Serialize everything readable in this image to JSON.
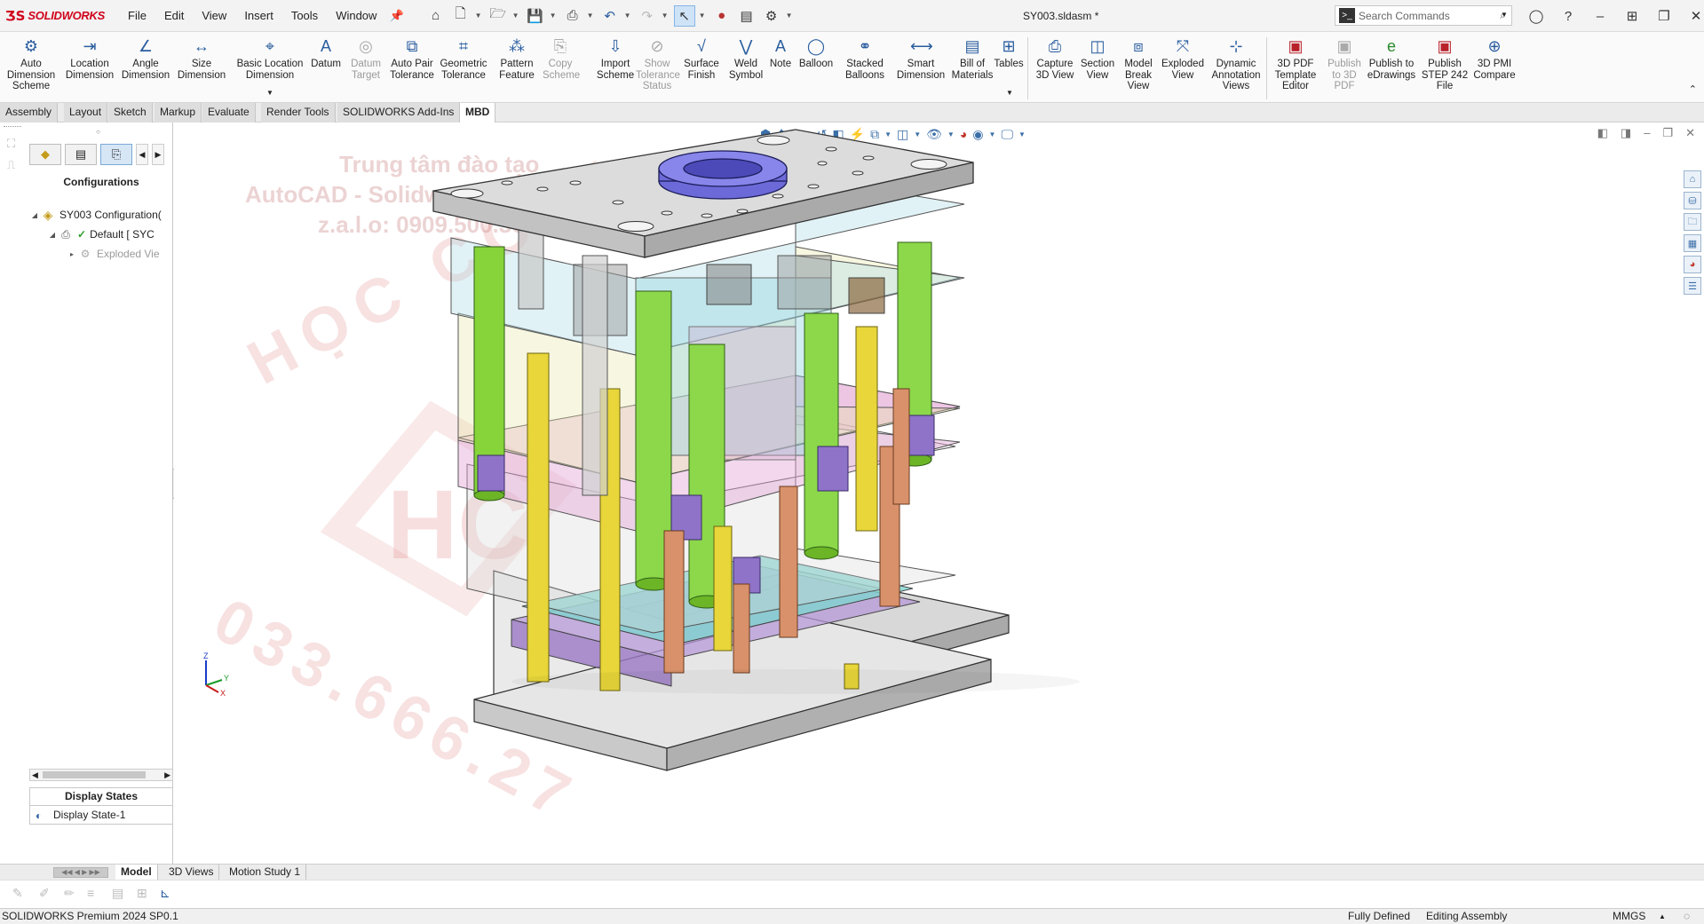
{
  "app": {
    "name": "SOLIDWORKS",
    "doc_title": "SY003.sldasm *"
  },
  "menu": [
    "File",
    "Edit",
    "View",
    "Insert",
    "Tools",
    "Window"
  ],
  "search": {
    "placeholder": "Search Commands"
  },
  "ribbon": [
    {
      "label": "Auto Dimension Scheme",
      "icon": "auto-dimension-icon",
      "enabled": true
    },
    {
      "label": "Location Dimension",
      "icon": "location-dimension-icon",
      "enabled": true
    },
    {
      "label": "Angle Dimension",
      "icon": "angle-dimension-icon",
      "enabled": true
    },
    {
      "label": "Size Dimension",
      "icon": "size-dimension-icon",
      "enabled": true
    },
    {
      "label": "Basic Location Dimension",
      "icon": "basic-location-icon",
      "enabled": true
    },
    {
      "label": "Datum",
      "icon": "datum-icon",
      "enabled": true
    },
    {
      "label": "Datum Target",
      "icon": "datum-target-icon",
      "enabled": false
    },
    {
      "label": "Auto Pair Tolerance",
      "icon": "auto-pair-icon",
      "enabled": true
    },
    {
      "label": "Geometric Tolerance",
      "icon": "geometric-tolerance-icon",
      "enabled": true
    },
    {
      "label": "Pattern Feature",
      "icon": "pattern-feature-icon",
      "enabled": true
    },
    {
      "label": "Copy Scheme",
      "icon": "copy-scheme-icon",
      "enabled": false
    },
    {
      "label": "Import Scheme",
      "icon": "import-scheme-icon",
      "enabled": true
    },
    {
      "label": "Show Tolerance Status",
      "icon": "tolerance-status-icon",
      "enabled": false
    },
    {
      "label": "Surface Finish",
      "icon": "surface-finish-icon",
      "enabled": true
    },
    {
      "label": "Weld Symbol",
      "icon": "weld-symbol-icon",
      "enabled": true
    },
    {
      "label": "Note",
      "icon": "note-icon",
      "enabled": true
    },
    {
      "label": "Balloon",
      "icon": "balloon-icon",
      "enabled": true
    },
    {
      "label": "Stacked Balloons",
      "icon": "stacked-balloons-icon",
      "enabled": true
    },
    {
      "label": "Smart Dimension",
      "icon": "smart-dimension-icon",
      "enabled": true
    },
    {
      "label": "Bill of Materials",
      "icon": "bill-of-materials-icon",
      "enabled": true
    },
    {
      "label": "Tables",
      "icon": "tables-icon",
      "enabled": true
    },
    {
      "label": "Capture 3D View",
      "icon": "capture-3d-view-icon",
      "enabled": true
    },
    {
      "label": "Section View",
      "icon": "section-view-icon",
      "enabled": true
    },
    {
      "label": "Model Break View",
      "icon": "model-break-view-icon",
      "enabled": true
    },
    {
      "label": "Exploded View",
      "icon": "exploded-view-icon",
      "enabled": true
    },
    {
      "label": "Dynamic Annotation Views",
      "icon": "dynamic-annotation-icon",
      "enabled": true
    },
    {
      "label": "3D PDF Template Editor",
      "icon": "pdf-template-icon",
      "enabled": true
    },
    {
      "label": "Publish to 3D PDF",
      "icon": "publish-3d-pdf-icon",
      "enabled": false
    },
    {
      "label": "Publish to eDrawings",
      "icon": "edrawings-icon",
      "enabled": true
    },
    {
      "label": "Publish STEP 242 File",
      "icon": "step-242-icon",
      "enabled": true
    },
    {
      "label": "3D PMI Compare",
      "icon": "pmi-compare-icon",
      "enabled": true
    }
  ],
  "tabs": [
    "Assembly",
    "Layout",
    "Sketch",
    "Markup",
    "Evaluate",
    "Render Tools",
    "SOLIDWORKS Add-Ins",
    "MBD"
  ],
  "active_tab": "MBD",
  "panel": {
    "title": "Configurations",
    "tree": [
      {
        "label": "SY003 Configuration(",
        "level": 0
      },
      {
        "label": "Default [ SYC",
        "level": 1
      },
      {
        "label": "Exploded Vie",
        "level": 2
      }
    ],
    "display_states_title": "Display States",
    "display_state": "Display State-1"
  },
  "watermark": {
    "line1": "Trung tâm đào tạo",
    "line2": "AutoCAD - Solidworks - Mastercam",
    "line3": "z.a.l.o: 0909.500.365",
    "arc_text": "HỌC CƠ K",
    "logo_text": "HC",
    "phone": "033.666.27"
  },
  "bottom_tabs": [
    "Model",
    "3D Views",
    "Motion Study 1"
  ],
  "status": {
    "left": "SOLIDWORKS Premium 2024 SP0.1",
    "defined": "Fully Defined",
    "mode": "Editing Assembly",
    "units": "MMGS"
  }
}
